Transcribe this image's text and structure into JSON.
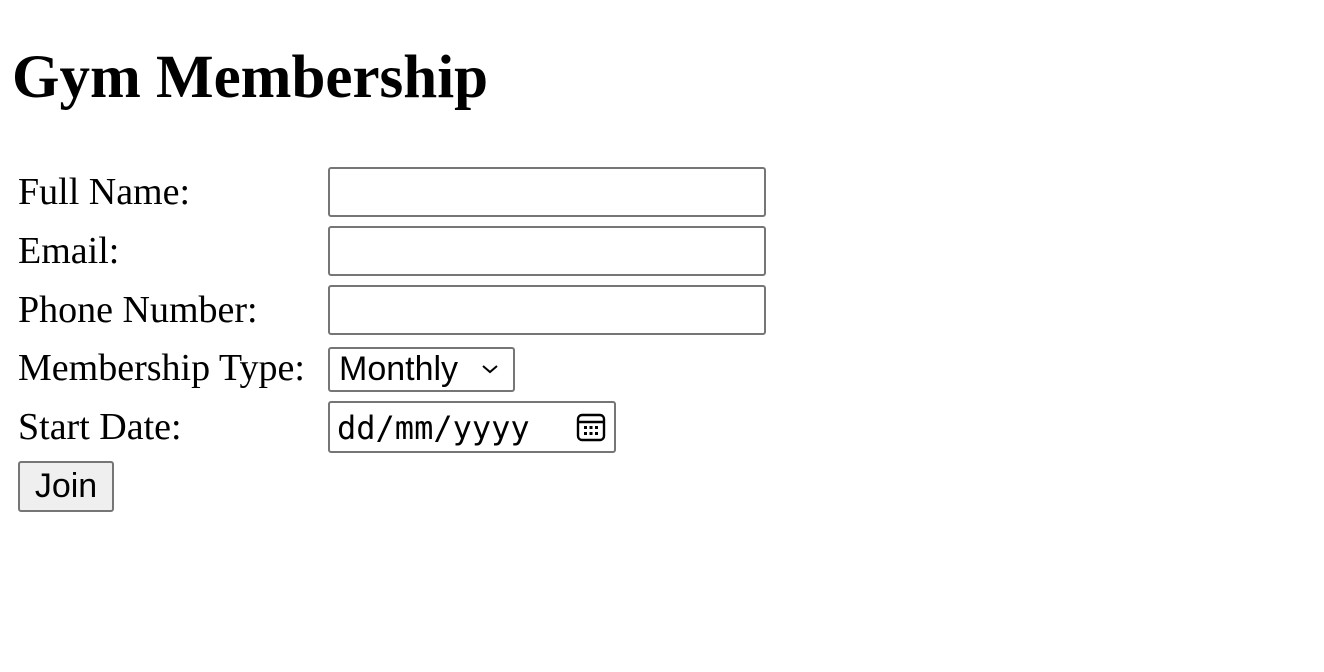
{
  "page": {
    "title": "Gym Membership"
  },
  "form": {
    "full_name": {
      "label": "Full Name:",
      "value": ""
    },
    "email": {
      "label": "Email:",
      "value": ""
    },
    "phone": {
      "label": "Phone Number:",
      "value": ""
    },
    "membership_type": {
      "label": "Membership Type:",
      "selected": "Monthly"
    },
    "start_date": {
      "label": "Start Date:",
      "placeholder": "dd/mm/yyyy"
    },
    "submit_label": "Join"
  },
  "icons": {
    "select_arrow": "chevron-down-icon",
    "date_picker": "calendar-icon"
  }
}
